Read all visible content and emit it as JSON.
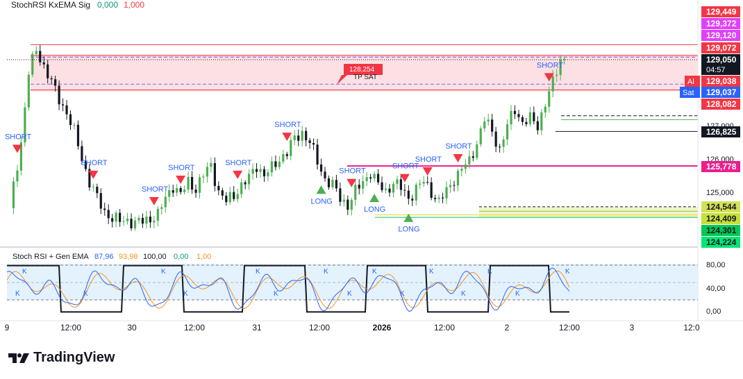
{
  "header": {
    "study_name": "StochRSI KxEMA Sig",
    "val_a": "0,000",
    "val_b": "1,000",
    "colors": {
      "val_a": "#089981",
      "val_b": "#f23645"
    }
  },
  "osc_header": {
    "name": "Stoch RSI + Gen EMA",
    "k": "87,96",
    "d": "93,98",
    "v3": "100,00",
    "v4": "0,00",
    "v5": "1,00",
    "colors": {
      "k": "#2962ff",
      "d": "#f7931a",
      "v3": "#131722",
      "v4": "#089981",
      "v5": "#f7931a"
    }
  },
  "price_scale": {
    "ticks": [
      "127,000",
      "126,000",
      "125,000"
    ],
    "labels": [
      {
        "text": "129,449",
        "bg": "#f23645",
        "fg": "#ffffff"
      },
      {
        "text": "129,372",
        "bg": "#e040fb",
        "fg": "#ffffff"
      },
      {
        "text": "129,120",
        "bg": "#e040fb",
        "fg": "#ffffff"
      },
      {
        "text": "129,072",
        "bg": "#f23645",
        "fg": "#ffffff"
      },
      {
        "text": "129,050",
        "sub": "04:57",
        "bg": "#131722",
        "fg": "#ffffff"
      },
      {
        "text": "129,038",
        "tag": "Al",
        "bg": "#f23645",
        "fg": "#ffffff"
      },
      {
        "text": "129,037",
        "tag": "Sat",
        "bg": "#2962ff",
        "fg": "#ffffff"
      },
      {
        "text": "128,082",
        "bg": "#f23645",
        "fg": "#ffffff"
      },
      {
        "text": "126,825",
        "bg": "#131722",
        "fg": "#ffffff"
      },
      {
        "text": "125,778",
        "bg": "#e91e8c",
        "fg": "#ffffff"
      },
      {
        "text": "124,544",
        "bg": "#d4e157",
        "fg": "#131722"
      },
      {
        "text": "124,409",
        "bg": "#c6e03a",
        "fg": "#131722"
      },
      {
        "text": "124,301",
        "bg": "#00c853",
        "fg": "#131722"
      },
      {
        "text": "124,224",
        "bg": "#00e676",
        "fg": "#131722"
      }
    ]
  },
  "osc_scale": {
    "ticks": [
      "80,00",
      "40,00",
      "0,00"
    ]
  },
  "time_axis": {
    "labels": [
      "9",
      "12:00",
      "30",
      "12:00",
      "31",
      "12:00",
      "2026",
      "12:00",
      "2",
      "12:00",
      "3",
      "12:0"
    ]
  },
  "callout": {
    "value": "128,254",
    "text": "TP SAT"
  },
  "signals": {
    "short": "SHORT",
    "long": "LONG",
    "k": "K"
  },
  "branding": {
    "name": "TradingView"
  },
  "chart_data": {
    "type": "candlestick",
    "x": [
      "9",
      "12:00",
      "30",
      "12:00",
      "31",
      "12:00",
      "2026",
      "12:00",
      "2",
      "12:00",
      "3"
    ],
    "ylim": [
      124000,
      129900
    ],
    "levels": [
      129449,
      129372,
      129120,
      129072,
      129050,
      129038,
      129037,
      128254,
      128082,
      126825,
      125778,
      124544,
      124409,
      124301,
      124224
    ],
    "close_path": [
      [
        0,
        124500
      ],
      [
        3,
        126500
      ],
      [
        5,
        128600
      ],
      [
        7,
        129300
      ],
      [
        9,
        128800
      ],
      [
        11,
        128300
      ],
      [
        13,
        127800
      ],
      [
        15,
        127400
      ],
      [
        17,
        126800
      ],
      [
        19,
        126000
      ],
      [
        21,
        125300
      ],
      [
        23,
        124800
      ],
      [
        25,
        124400
      ],
      [
        27,
        124200
      ],
      [
        29,
        124100
      ],
      [
        31,
        124150
      ],
      [
        33,
        124050
      ],
      [
        35,
        124100
      ],
      [
        37,
        124200
      ],
      [
        39,
        124300
      ],
      [
        41,
        124800
      ],
      [
        43,
        125200
      ],
      [
        45,
        124900
      ],
      [
        47,
        125300
      ],
      [
        49,
        125100
      ],
      [
        51,
        125500
      ],
      [
        53,
        125800
      ],
      [
        55,
        125000
      ],
      [
        57,
        124700
      ],
      [
        59,
        124900
      ],
      [
        61,
        125200
      ],
      [
        63,
        125400
      ],
      [
        65,
        125800
      ],
      [
        67,
        125500
      ],
      [
        69,
        125700
      ],
      [
        71,
        126000
      ],
      [
        73,
        126200
      ],
      [
        75,
        126600
      ],
      [
        77,
        126800
      ],
      [
        79,
        126500
      ],
      [
        81,
        125900
      ],
      [
        83,
        125400
      ],
      [
        85,
        125200
      ],
      [
        87,
        124800
      ],
      [
        89,
        124600
      ],
      [
        91,
        125000
      ],
      [
        93,
        125300
      ],
      [
        95,
        125600
      ],
      [
        97,
        125200
      ],
      [
        99,
        125000
      ],
      [
        101,
        125300
      ],
      [
        103,
        125100
      ],
      [
        105,
        124800
      ],
      [
        107,
        125100
      ],
      [
        109,
        125300
      ],
      [
        111,
        125000
      ],
      [
        113,
        124700
      ],
      [
        115,
        125000
      ],
      [
        117,
        125400
      ],
      [
        119,
        125700
      ],
      [
        121,
        125900
      ],
      [
        123,
        126500
      ],
      [
        125,
        127200
      ],
      [
        127,
        126800
      ],
      [
        129,
        126300
      ],
      [
        131,
        127000
      ],
      [
        133,
        127500
      ],
      [
        135,
        127100
      ],
      [
        137,
        127200
      ],
      [
        139,
        127000
      ],
      [
        141,
        127700
      ],
      [
        143,
        128300
      ],
      [
        145,
        129000
      ],
      [
        146,
        129050
      ]
    ],
    "short_signals_at": [
      2,
      22,
      38,
      45,
      60,
      73,
      90,
      104,
      110,
      118,
      142
    ],
    "long_signals_at": [
      82,
      96,
      105
    ],
    "oscillator": {
      "series": [
        {
          "name": "K",
          "color": "#2962ff"
        },
        {
          "name": "D",
          "color": "#f7931a"
        }
      ],
      "ylim": [
        0,
        100
      ],
      "bands": [
        20,
        50,
        80
      ]
    }
  }
}
